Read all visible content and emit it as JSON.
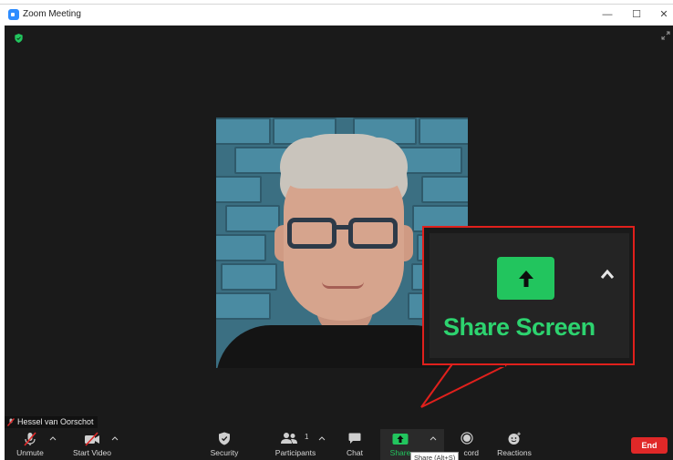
{
  "window": {
    "title": "Zoom Meeting",
    "controls": {
      "minimize": "—",
      "maximize": "☐",
      "close": "✕"
    }
  },
  "participant": {
    "name": "Hessel van Oorschot"
  },
  "zoom_callout": {
    "label": "Share Screen"
  },
  "toolbar": {
    "unmute": "Unmute",
    "start_video": "Start Video",
    "security": "Security",
    "participants": "Participants",
    "participants_count": "1",
    "chat": "Chat",
    "share_visible": "Share",
    "record_visible": "cord",
    "reactions": "Reactions",
    "end": "End"
  },
  "tooltip": {
    "text": "Share (Alt+S)"
  },
  "colors": {
    "stage_bg": "#1a1a1a",
    "share_green": "#22c55e",
    "end_red": "#e02828",
    "callout_border": "#e0201c"
  }
}
